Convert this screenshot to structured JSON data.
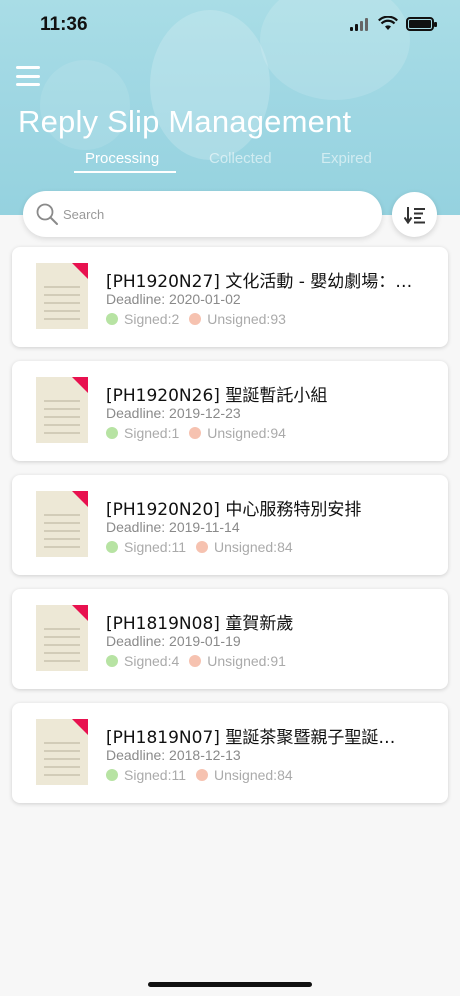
{
  "status_bar": {
    "time": "11:36"
  },
  "header": {
    "title": "Reply Slip Management",
    "tabs": [
      {
        "label": "Processing",
        "active": true
      },
      {
        "label": "Collected",
        "active": false
      },
      {
        "label": "Expired",
        "active": false
      }
    ]
  },
  "search": {
    "placeholder": "Search",
    "value": ""
  },
  "labels": {
    "deadline_prefix": "Deadline: ",
    "signed_prefix": "Signed: ",
    "unsigned_prefix": "Unsigned: "
  },
  "items": [
    {
      "title": "[PH1920N27] 文化活動 - 嬰幼劇場：小小…",
      "deadline": "2020-01-02",
      "signed": 2,
      "unsigned": 93
    },
    {
      "title": "[PH1920N26] 聖誕暫託小組",
      "deadline": "2019-12-23",
      "signed": 1,
      "unsigned": 94
    },
    {
      "title": "[PH1920N20] 中心服務特別安排",
      "deadline": "2019-11-14",
      "signed": 11,
      "unsigned": 84
    },
    {
      "title": "[PH1819N08] 童賀新歲",
      "deadline": "2019-01-19",
      "signed": 4,
      "unsigned": 91
    },
    {
      "title": "[PH1819N07] 聖誕茶聚暨親子聖誕…",
      "deadline": "2018-12-13",
      "signed": 11,
      "unsigned": 84
    }
  ],
  "colors": {
    "header_bg": "#9fd7e3",
    "signed_dot": "#b7e3a3",
    "unsigned_dot": "#f6c2b0",
    "doc_icon_corner": "#e8114f",
    "doc_icon_body": "#ede8d6"
  }
}
